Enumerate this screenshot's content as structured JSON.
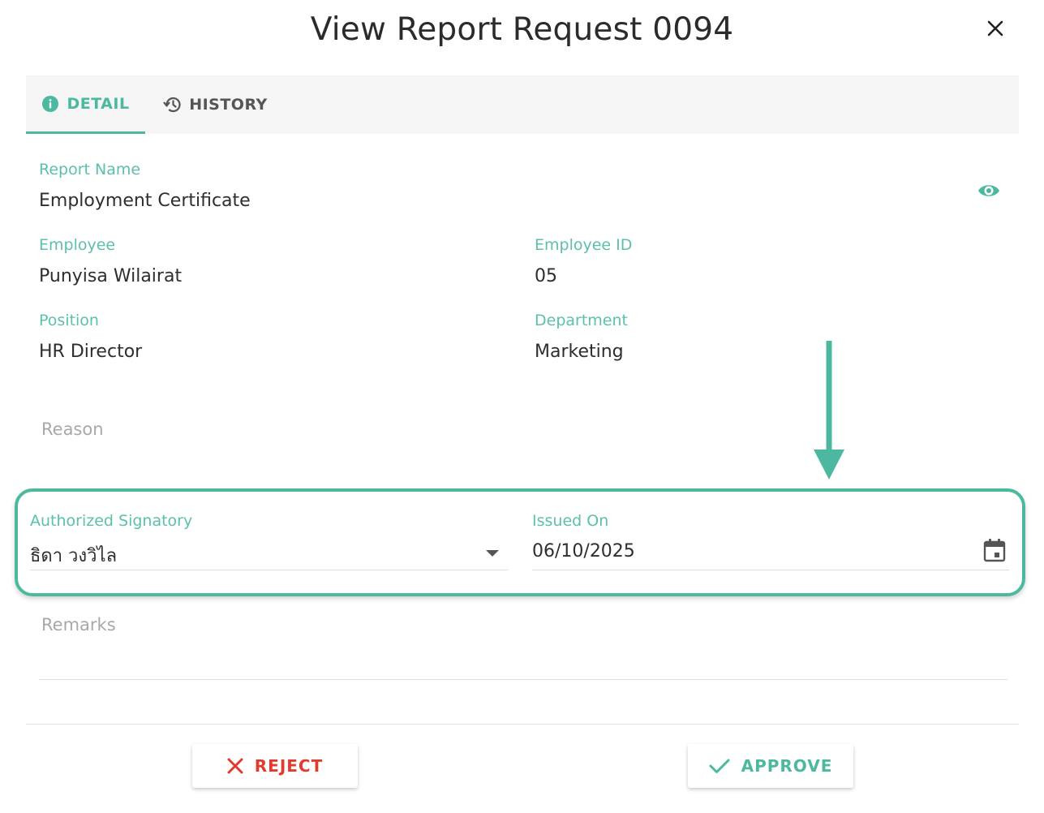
{
  "dialog": {
    "title": "View Report Request 0094"
  },
  "tabs": {
    "detail_label": "DETAIL",
    "history_label": "HISTORY",
    "active": "detail"
  },
  "fields": {
    "report_name": {
      "label": "Report Name",
      "value": "Employment Certificate"
    },
    "employee": {
      "label": "Employee",
      "value": "Punyisa Wilairat"
    },
    "employee_id": {
      "label": "Employee ID",
      "value": "05"
    },
    "position": {
      "label": "Position",
      "value": "HR Director"
    },
    "department": {
      "label": "Department",
      "value": "Marketing"
    },
    "reason": {
      "placeholder": "Reason"
    },
    "authorized_signatory": {
      "label": "Authorized Signatory",
      "value": "ธิดา วงวิไล"
    },
    "issued_on": {
      "label": "Issued On",
      "value": "06/10/2025"
    },
    "remarks": {
      "placeholder": "Remarks"
    }
  },
  "actions": {
    "reject_label": "REJECT",
    "approve_label": "APPROVE"
  },
  "icons": {
    "close": "close-icon",
    "info": "info-icon",
    "history": "history-icon",
    "eye": "eye-icon",
    "dropdown": "dropdown-arrow-icon",
    "calendar": "calendar-icon",
    "reject": "x-icon",
    "approve": "check-icon",
    "annotation_arrow": "down-arrow-annotation"
  },
  "colors": {
    "accent": "#4db8a0",
    "label": "#5cc0aa",
    "reject": "#e23a2e",
    "placeholder": "#a8a8a8"
  }
}
